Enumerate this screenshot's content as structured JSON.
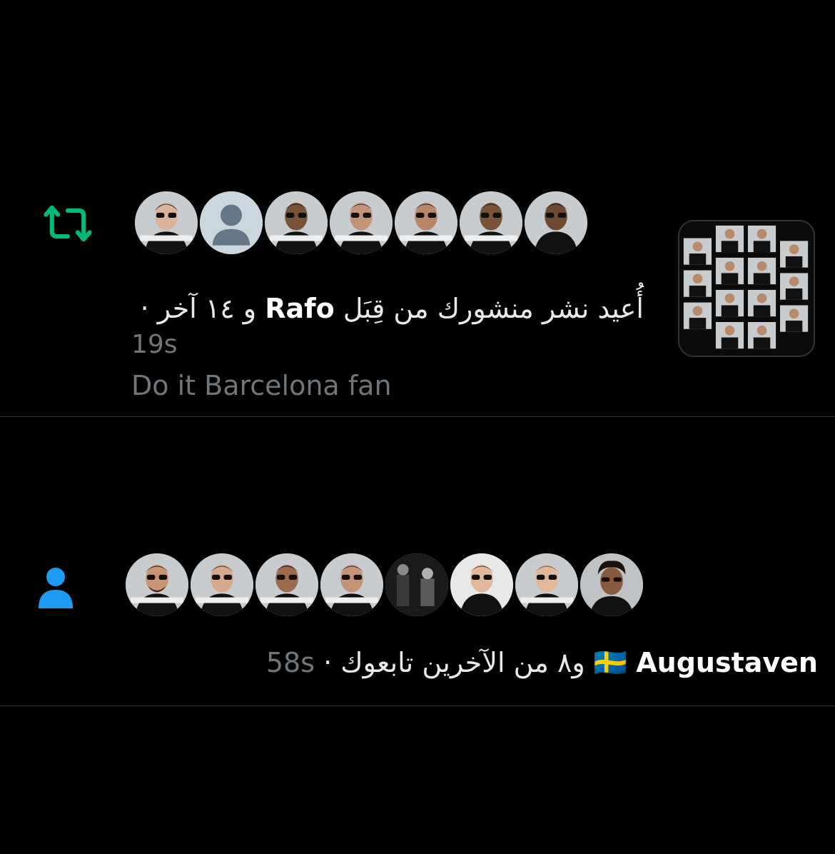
{
  "notifications": [
    {
      "type": "retweet",
      "icon": "retweet-icon",
      "icon_color": "#00ba7c",
      "avatar_count": 7,
      "text_prefix": "أُعيد نشر منشورك من قِبَل",
      "actor_name": "Rafo",
      "text_suffix": "و ١٤ آخر ·",
      "time": "19s",
      "snippet": "Do it Barcelona fan",
      "has_media_thumbnail": true
    },
    {
      "type": "follow",
      "icon": "person-icon",
      "icon_color": "#1d9bf0",
      "avatar_count": 8,
      "flag": "🇸🇪",
      "actor_name": "Augustaven",
      "text_suffix": "و٨ من الآخرين تابعوك ·",
      "time": "58s"
    }
  ]
}
